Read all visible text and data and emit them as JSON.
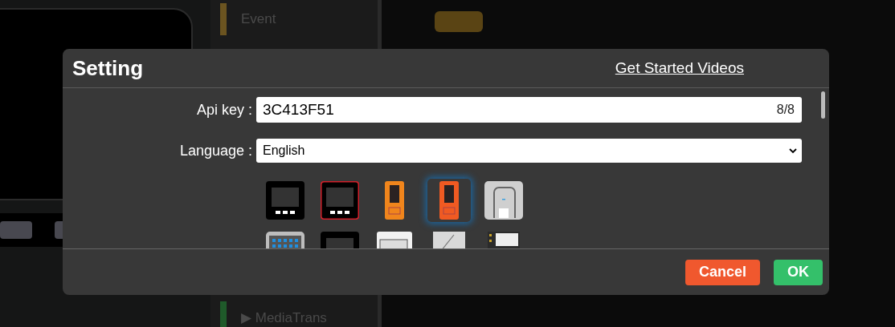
{
  "background": {
    "sidebar_items": [
      {
        "label": "Event",
        "color": "#6b5420"
      },
      {
        "label": "▶ MediaTrans",
        "color": "#1f5a2a"
      }
    ]
  },
  "dialog": {
    "title": "Setting",
    "link": "Get Started Videos",
    "api_key": {
      "label": "Api key :",
      "value": "3C413F51",
      "counter": "8/8"
    },
    "language": {
      "label": "Language :",
      "value": "English"
    },
    "devices": [
      {
        "kind": "core",
        "color": "#000000",
        "selected": false
      },
      {
        "kind": "core",
        "color": "#d0202a",
        "selected": false
      },
      {
        "kind": "stick",
        "color": "#f0851c",
        "selected": false
      },
      {
        "kind": "stick",
        "color": "#f05a22",
        "selected": true
      },
      {
        "kind": "unit",
        "color": "#cfcfcf",
        "selected": false
      },
      {
        "kind": "keyboard",
        "color": "#bdbdbd",
        "selected": false
      },
      {
        "kind": "core",
        "color": "#000000",
        "selected": false
      },
      {
        "kind": "board",
        "color": "#f2f2f2",
        "selected": false
      },
      {
        "kind": "plate",
        "color": "#d9d9d9",
        "selected": false
      },
      {
        "kind": "chip",
        "color": "#2b2b2b",
        "selected": false
      }
    ],
    "buttons": [
      {
        "label": "Cancel",
        "kind": "cancel"
      },
      {
        "label": "OK",
        "kind": "ok"
      }
    ]
  }
}
